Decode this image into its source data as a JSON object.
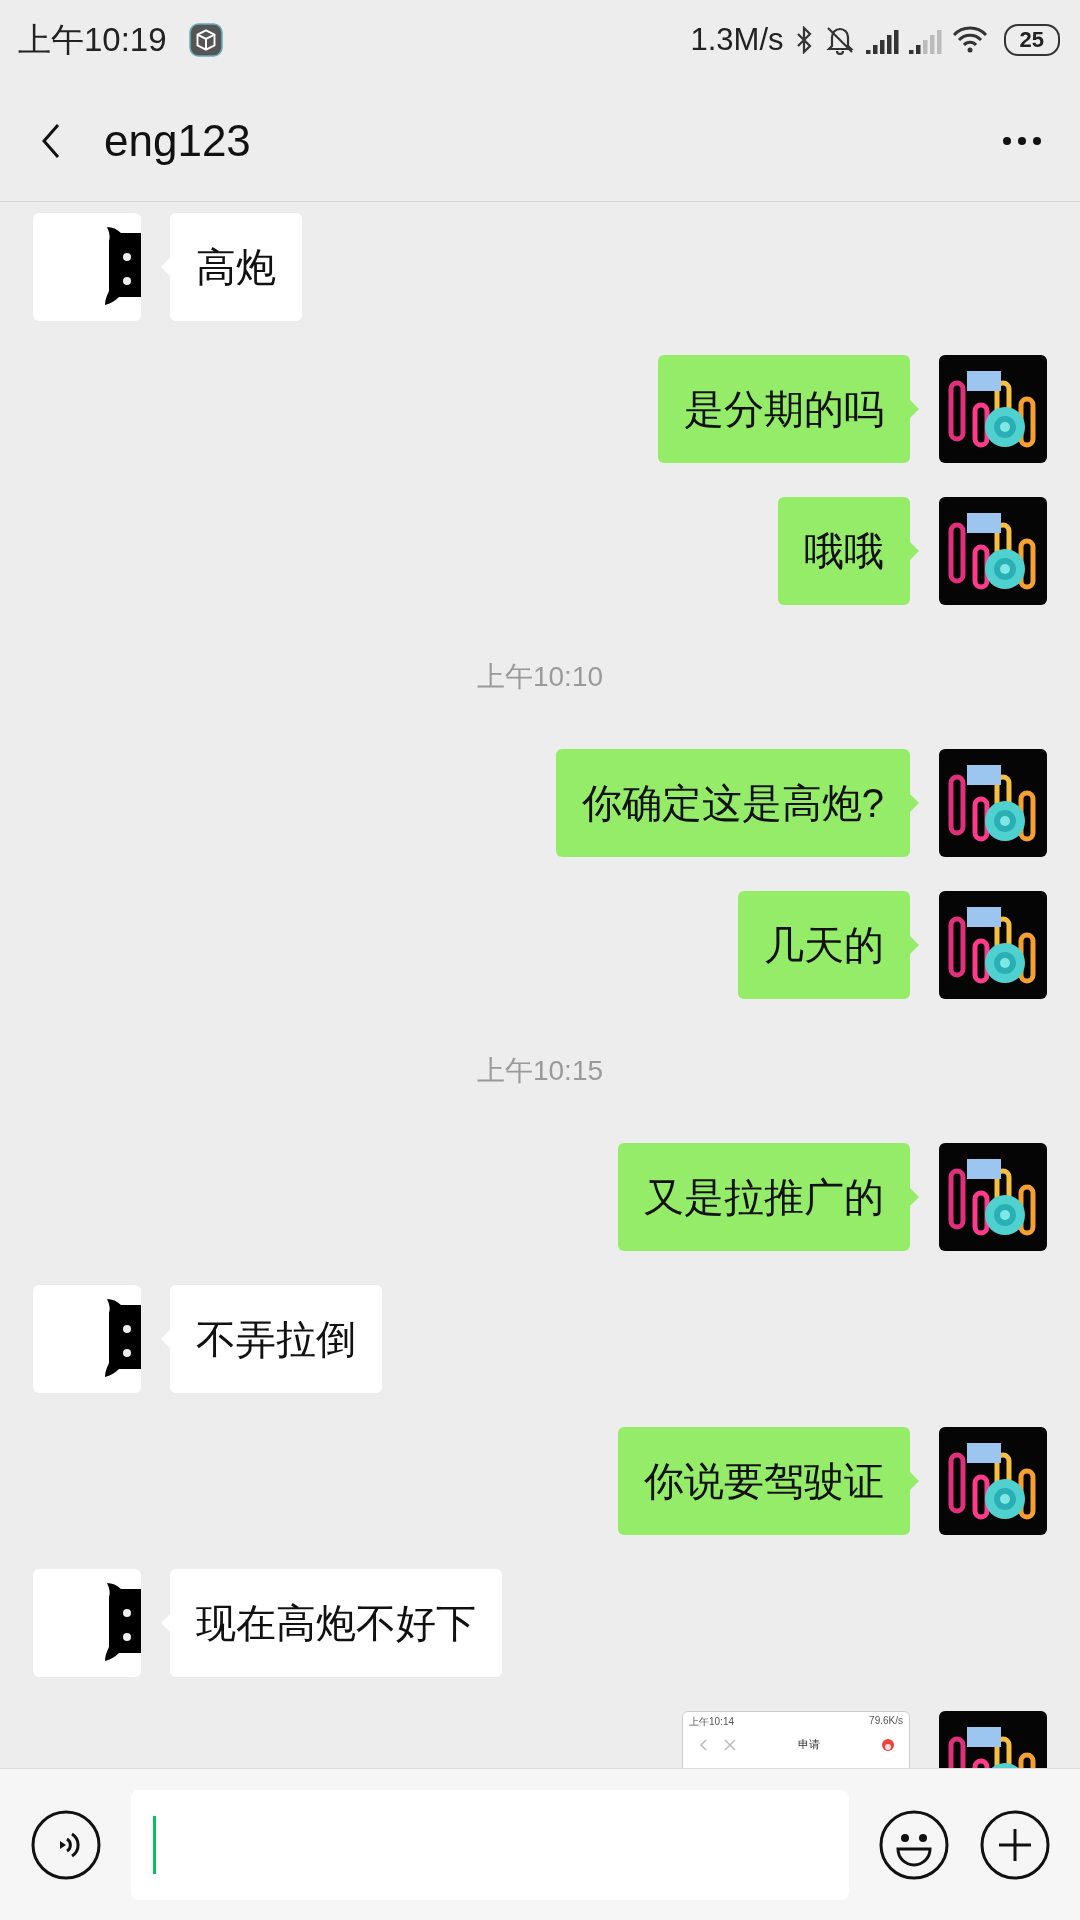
{
  "status_bar": {
    "time": "上午10:19",
    "speed": "1.3M/s",
    "battery": "25"
  },
  "header": {
    "title": "eng123"
  },
  "messages": [
    {
      "kind": "text",
      "outgoing": false,
      "text": "高炮"
    },
    {
      "kind": "text",
      "outgoing": true,
      "text": "是分期的吗"
    },
    {
      "kind": "text",
      "outgoing": true,
      "text": "哦哦"
    },
    {
      "kind": "time",
      "text": "上午10:10"
    },
    {
      "kind": "text",
      "outgoing": true,
      "text": "你确定这是高炮?"
    },
    {
      "kind": "text",
      "outgoing": true,
      "text": "几天的"
    },
    {
      "kind": "time",
      "text": "上午10:15"
    },
    {
      "kind": "text",
      "outgoing": true,
      "text": "又是拉推广的"
    },
    {
      "kind": "text",
      "outgoing": false,
      "text": "不弄拉倒"
    },
    {
      "kind": "text",
      "outgoing": true,
      "text": "你说要驾驶证"
    },
    {
      "kind": "text",
      "outgoing": false,
      "text": "现在高炮不好下"
    },
    {
      "outgoing": true,
      "image": {
        "time": "上午10:14",
        "speed": "79.6K/s",
        "title": "申请"
      }
    }
  ]
}
